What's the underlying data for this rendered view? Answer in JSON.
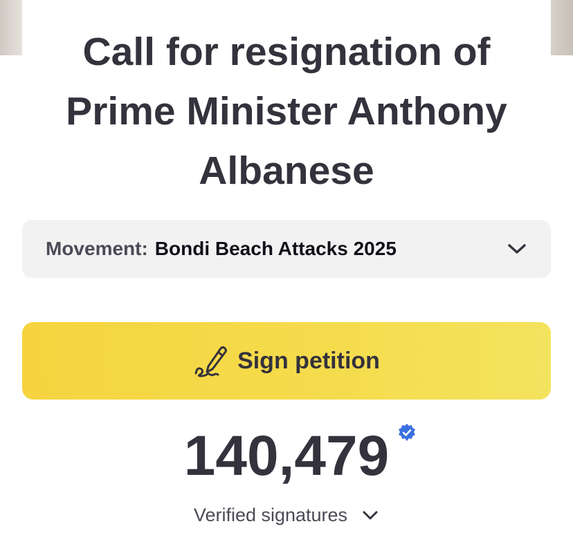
{
  "title_lines": [
    "Call for resignation of",
    "Prime Minister Anthony",
    "Albanese"
  ],
  "movement": {
    "label": "Movement:",
    "value": "Bondi Beach Attacks 2025"
  },
  "sign_button": {
    "label": "Sign petition",
    "icon": "pen-signature-icon"
  },
  "signatures": {
    "count": "140,479",
    "label": "Verified signatures",
    "badge_icon": "verified-check-icon"
  },
  "colors": {
    "accent_yellow": "#f5d83f",
    "text_dark": "#34323c",
    "verified_blue": "#3b6fe0",
    "movement_bg": "#f2f2f3"
  }
}
